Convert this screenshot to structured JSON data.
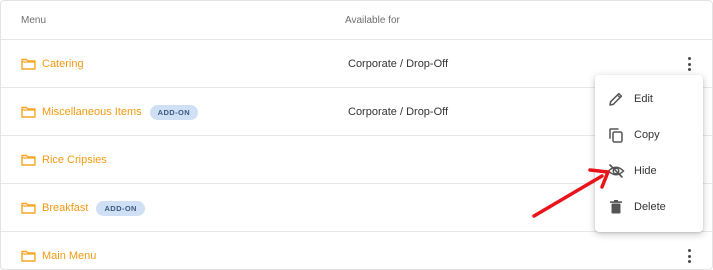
{
  "table": {
    "headers": {
      "menu": "Menu",
      "available_for": "Available for"
    },
    "rows": [
      {
        "name": "Catering",
        "badge": "",
        "available_for": "Corporate / Drop-Off",
        "has_actions": true
      },
      {
        "name": "Miscellaneous Items",
        "badge": "ADD-ON",
        "available_for": "Corporate / Drop-Off",
        "has_actions": false
      },
      {
        "name": "Rice Cripsies",
        "badge": "",
        "available_for": "",
        "has_actions": false
      },
      {
        "name": "Breakfast",
        "badge": "ADD-ON",
        "available_for": "",
        "has_actions": false
      },
      {
        "name": "Main Menu",
        "badge": "",
        "available_for": "",
        "has_actions": true
      }
    ]
  },
  "context_menu": {
    "items": [
      {
        "label": "Edit",
        "icon": "pencil-icon"
      },
      {
        "label": "Copy",
        "icon": "copy-icon"
      },
      {
        "label": "Hide",
        "icon": "eye-off-icon"
      },
      {
        "label": "Delete",
        "icon": "trash-icon"
      }
    ]
  },
  "colors": {
    "folder": "#f5a623",
    "name_text": "#f39a12",
    "badge_bg": "#cfe0f5",
    "annotation_arrow": "#e8141a"
  }
}
